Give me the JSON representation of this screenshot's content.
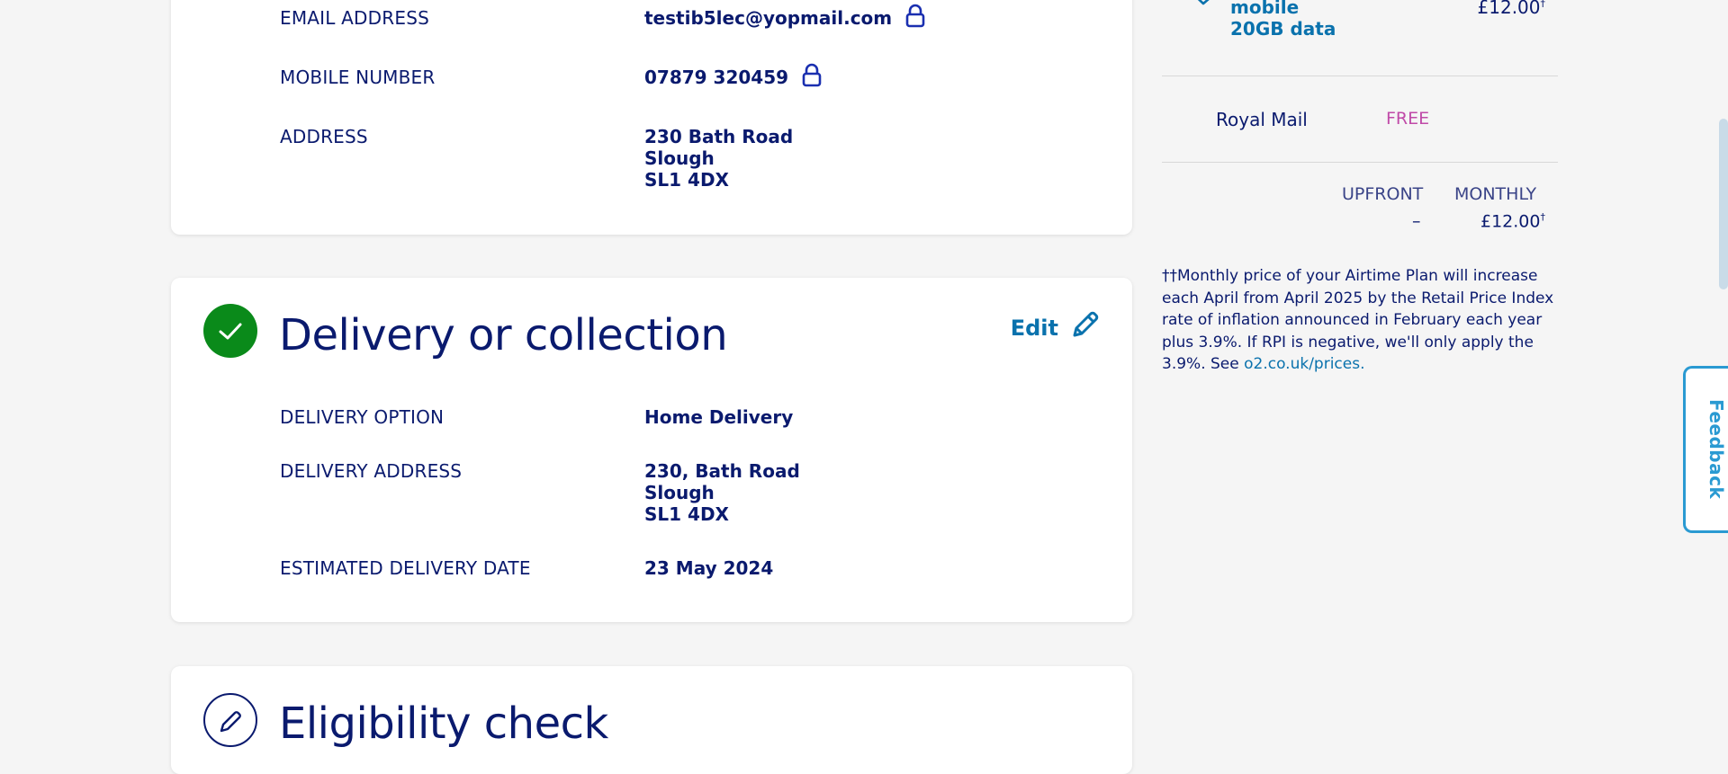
{
  "contact": {
    "email_label": "EMAIL ADDRESS",
    "email_value": "testib5lec@yopmail.com",
    "mobile_label": "MOBILE NUMBER",
    "mobile_value": "07879 320459",
    "address_label": "ADDRESS",
    "address_lines": [
      "230 Bath Road",
      "Slough",
      "SL1 4DX"
    ]
  },
  "delivery": {
    "title": "Delivery or collection",
    "edit_label": "Edit",
    "option_label": "DELIVERY OPTION",
    "option_value": "Home Delivery",
    "address_label": "DELIVERY ADDRESS",
    "address_lines": [
      "230, Bath Road",
      "Slough",
      "SL1 4DX"
    ],
    "date_label": "ESTIMATED DELIVERY DATE",
    "date_value": "23 May 2024"
  },
  "eligibility": {
    "title": "Eligibility check"
  },
  "summary": {
    "plan_lines": [
      "mobile",
      "20GB data"
    ],
    "plan_price": "£12.00",
    "dagger": "†",
    "delivery_method": "Royal Mail",
    "delivery_cost": "FREE",
    "upfront_label": "UPFRONT",
    "monthly_label": "MONTHLY",
    "upfront_value": "–",
    "monthly_value": "£12.00",
    "footnote_text": "††Monthly price of your Airtime Plan will increase each April from April 2025 by the Retail Price Index rate of inflation announced in February each year plus 3.9%. If RPI is negative, we'll only apply the 3.9%. See ",
    "footnote_link": "o2.co.uk/prices."
  },
  "feedback": {
    "label": "Feedback"
  },
  "colors": {
    "navy": "#0a1a6e",
    "link_blue": "#0a72ad",
    "success_green": "#0a8a1a",
    "free_pink": "#c04aa8",
    "feedback_blue": "#2a9ad2"
  },
  "icons": [
    "lock-icon",
    "checkmark-icon",
    "pencil-icon",
    "chevron-check-icon"
  ]
}
